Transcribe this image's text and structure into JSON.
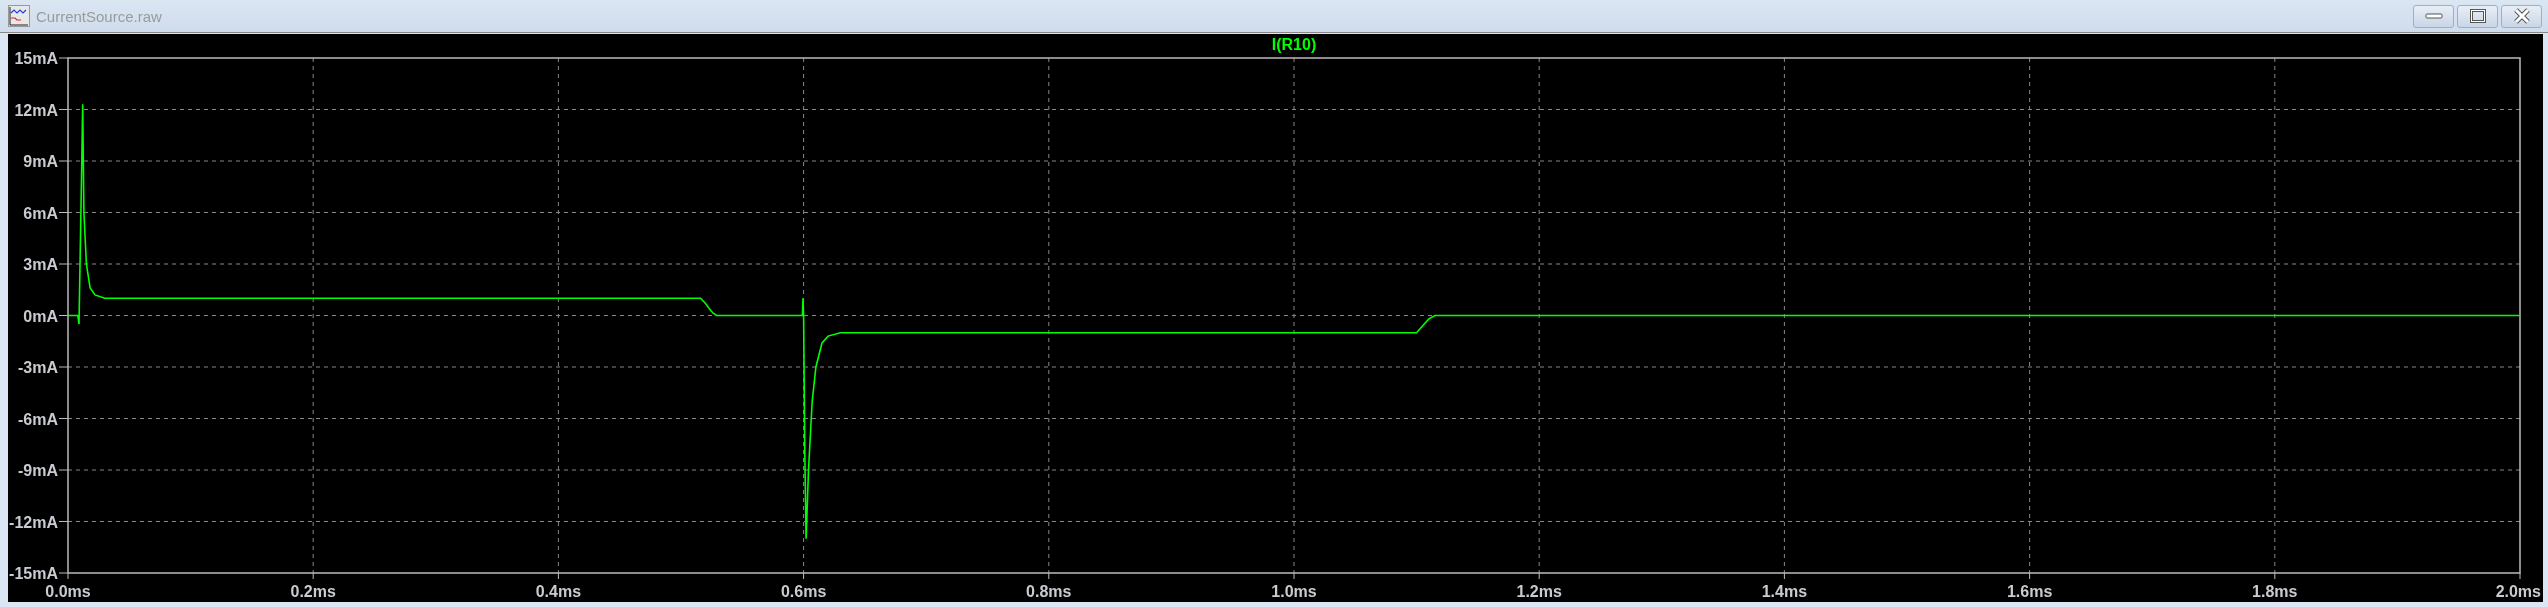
{
  "window": {
    "title": "CurrentSource.raw"
  },
  "plot": {
    "chart_data": {
      "type": "line",
      "grid": true,
      "x": [
        0,
        0.008,
        0.009,
        0.011,
        0.012,
        0.013,
        0.015,
        0.018,
        0.022,
        0.03,
        0.516,
        0.52,
        0.523,
        0.526,
        0.529,
        0.599,
        0.5995,
        0.6,
        0.601,
        0.602,
        0.604,
        0.607,
        0.61,
        0.615,
        0.62,
        0.63,
        1.1,
        1.105,
        1.11,
        1.115,
        2.0
      ],
      "series": [
        {
          "name": "I(R10)",
          "color": "#00ff00",
          "values": [
            0,
            0,
            -0.5,
            8,
            12.3,
            6,
            3,
            1.6,
            1.2,
            1.0,
            1.0,
            0.7,
            0.4,
            0.15,
            0,
            0,
            1.0,
            0,
            -8,
            -13,
            -9,
            -5,
            -3,
            -1.6,
            -1.2,
            -1.0,
            -1.0,
            -0.6,
            -0.2,
            0,
            0
          ]
        }
      ],
      "xlim": [
        0,
        2
      ],
      "ylim": [
        -15,
        15
      ],
      "xticks": [
        {
          "value": 0,
          "label": "0.0ms"
        },
        {
          "value": 0.2,
          "label": "0.2ms"
        },
        {
          "value": 0.4,
          "label": "0.4ms"
        },
        {
          "value": 0.6,
          "label": "0.6ms"
        },
        {
          "value": 0.8,
          "label": "0.8ms"
        },
        {
          "value": 1.0,
          "label": "1.0ms"
        },
        {
          "value": 1.2,
          "label": "1.2ms"
        },
        {
          "value": 1.4,
          "label": "1.4ms"
        },
        {
          "value": 1.6,
          "label": "1.6ms"
        },
        {
          "value": 1.8,
          "label": "1.8ms"
        },
        {
          "value": 2.0,
          "label": "2.0ms"
        }
      ],
      "yticks": [
        {
          "value": 15,
          "label": "15mA"
        },
        {
          "value": 12,
          "label": "12mA"
        },
        {
          "value": 9,
          "label": "9mA"
        },
        {
          "value": 6,
          "label": "6mA"
        },
        {
          "value": 3,
          "label": "3mA"
        },
        {
          "value": 0,
          "label": "0mA"
        },
        {
          "value": -3,
          "label": "-3mA"
        },
        {
          "value": -6,
          "label": "-6mA"
        },
        {
          "value": -9,
          "label": "-9mA"
        },
        {
          "value": -12,
          "label": "-12mA"
        },
        {
          "value": -15,
          "label": "-15mA"
        }
      ]
    }
  }
}
